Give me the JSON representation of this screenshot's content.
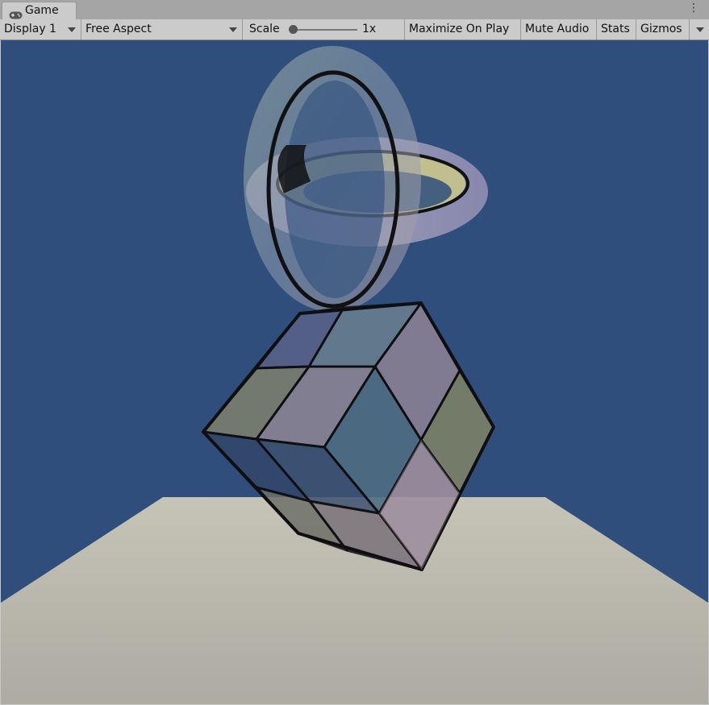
{
  "window": {
    "tab_title": "Game",
    "tab_icon": "gamepad-icon"
  },
  "toolbar": {
    "display_label": "Display 1",
    "aspect_label": "Free Aspect",
    "scale_label": "Scale",
    "scale_value": "1x",
    "maximize_label": "Maximize On Play",
    "mute_label": "Mute Audio",
    "stats_label": "Stats",
    "gizmos_label": "Gizmos"
  },
  "scene": {
    "sky_color": "#2f4e7c",
    "floor_color": "#b6b4a8",
    "objects": [
      "torus-upright",
      "torus-horizontal",
      "cube-2x2"
    ]
  }
}
